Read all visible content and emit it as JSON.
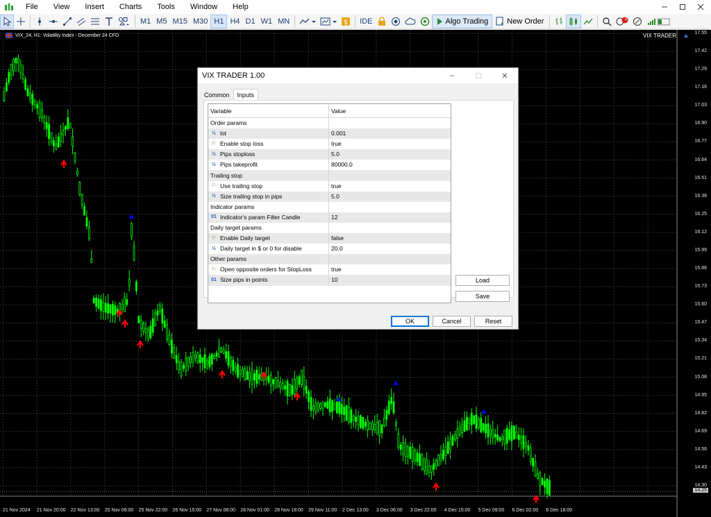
{
  "menubar": {
    "items": [
      "File",
      "View",
      "Insert",
      "Charts",
      "Tools",
      "Window",
      "Help"
    ]
  },
  "toolbar": {
    "timeframes": [
      "M1",
      "M5",
      "M15",
      "M30",
      "H1",
      "H4",
      "D1",
      "W1",
      "MN"
    ],
    "active_timeframe": "H1",
    "ide_label": "IDE",
    "algo_trading_label": "Algo Trading",
    "new_order_label": "New Order",
    "notification_count": "1"
  },
  "chart": {
    "header": "VIX_24, H1:  Volatility Index - December 24 CFD",
    "symbol": "VIX TRADER",
    "price_labels": [
      "17.55",
      "17.42",
      "17.29",
      "17.16",
      "17.03",
      "16.90",
      "16.77",
      "16.64",
      "16.51",
      "16.38",
      "16.25",
      "16.12",
      "15.99",
      "15.86",
      "15.73",
      "15.60",
      "15.47",
      "15.34",
      "15.21",
      "15.08",
      "14.95",
      "14.82",
      "14.69",
      "14.56",
      "14.43",
      "14.30"
    ],
    "current_price": "14.25",
    "time_labels": [
      "21 Nov 2024",
      "21 Nov 20:00",
      "22 Nov 13:00",
      "25 Nov 06:00",
      "25 Nov 22:00",
      "26 Nov 15:00",
      "27 Nov 08:00",
      "28 Nov 01:00",
      "28 Nov 18:00",
      "29 Nov 11:00",
      "2 Dec 13:00",
      "3 Dec 06:00",
      "3 Dec 22:00",
      "4 Dec 15:00",
      "5 Dec 09:00",
      "6 Dec 02:00",
      "6 Dec 18:00"
    ],
    "colors": {
      "background": "#000000",
      "candle": "#00ff00",
      "grid": "#2e2e2e",
      "up_arrow": "#0000ff",
      "down_arrow": "#ff0000"
    }
  },
  "dialog": {
    "title": "VIX TRADER 1.00",
    "tabs": [
      "Common",
      "Inputs"
    ],
    "active_tab": "Inputs",
    "columns": [
      "Variable",
      "Value"
    ],
    "rows": [
      {
        "type": "group",
        "variable": "Order params",
        "value": ""
      },
      {
        "type": "double",
        "variable": "lot",
        "value": "0.001"
      },
      {
        "type": "bool",
        "variable": "Enable stop loss",
        "value": "true"
      },
      {
        "type": "double",
        "variable": "Pips stoploss",
        "value": "5.0"
      },
      {
        "type": "double",
        "variable": "Pips takeprofit",
        "value": "80000.0"
      },
      {
        "type": "group",
        "variable": "Trailing stop",
        "value": ""
      },
      {
        "type": "bool",
        "variable": "Use trailing stop",
        "value": "true"
      },
      {
        "type": "double",
        "variable": "Size trailing stop in pips",
        "value": "5.0"
      },
      {
        "type": "group",
        "variable": "Indicator params",
        "value": ""
      },
      {
        "type": "int",
        "variable": "Indicator's param Filter Candle",
        "value": "12"
      },
      {
        "type": "group",
        "variable": "Daily target params",
        "value": ""
      },
      {
        "type": "bool",
        "variable": "Enable Daily target",
        "value": "false"
      },
      {
        "type": "double",
        "variable": "Daily target in $ or 0 for disable",
        "value": "20.0"
      },
      {
        "type": "group",
        "variable": "Other params",
        "value": ""
      },
      {
        "type": "bool",
        "variable": "Open opposite orders for StopLoss",
        "value": "true"
      },
      {
        "type": "int",
        "variable": "Size pips in points",
        "value": "10"
      }
    ],
    "load_label": "Load",
    "save_label": "Save",
    "ok_label": "OK",
    "cancel_label": "Cancel",
    "reset_label": "Reset"
  }
}
